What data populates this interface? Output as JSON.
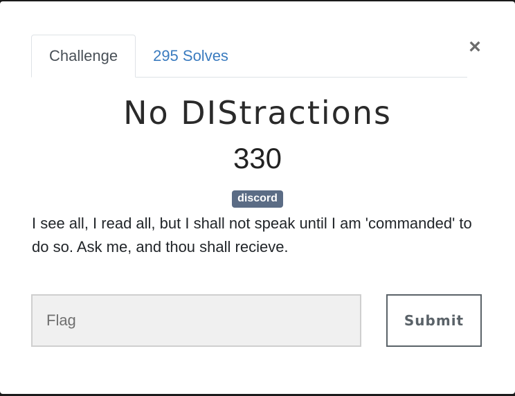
{
  "modal": {
    "close_glyph": "×",
    "tabs": [
      {
        "label": "Challenge",
        "active": true
      },
      {
        "label": "295 Solves",
        "active": false
      }
    ],
    "challenge": {
      "name": "No DIStractions",
      "points": "330",
      "tag": "discord",
      "description": "I see all, I read all, but I shall not speak until I am 'commanded' to do so. Ask me, and thou shall recieve."
    },
    "form": {
      "flag_placeholder": "Flag",
      "flag_value": "",
      "submit_label": "Submit"
    }
  },
  "colors": {
    "tag_background": "#5b6c85",
    "link": "#3a7bbf",
    "submit_border": "#5a6268",
    "input_background": "#f0f0f0"
  },
  "icons": {
    "close": "close-icon"
  }
}
